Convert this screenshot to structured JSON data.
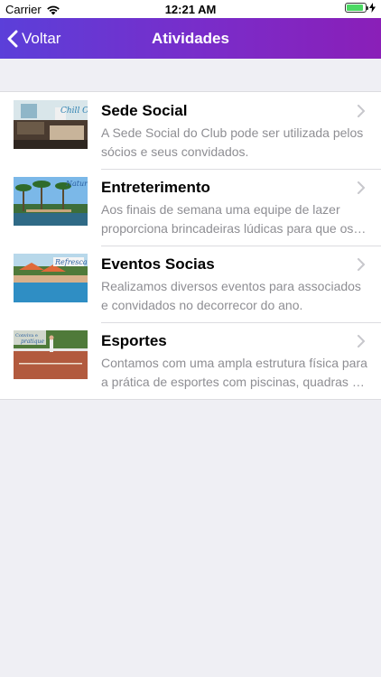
{
  "status_bar": {
    "carrier": "Carrier",
    "time": "12:21 AM",
    "battery_level": 0.9
  },
  "nav": {
    "back_label": "Voltar",
    "title": "Atividades",
    "gradient_start": "#5b3fd9",
    "gradient_end": "#8a1fb8"
  },
  "activities": [
    {
      "title": "Sede Social",
      "description": "A Sede Social do Club pode ser utilizada pelos sócios e seus convidados.",
      "thumb_caption": "Chill Out!",
      "thumb_icon": "lounge-photo"
    },
    {
      "title": "Entreterimento",
      "description": "Aos finais de semana uma equipe de lazer proporciona brincadeiras lúdicas para que os pequenos se divirtam.",
      "thumb_caption": "Natureza",
      "thumb_icon": "palm-trees-photo"
    },
    {
      "title": "Eventos Socias",
      "description": "Realizamos diversos eventos para associados e convidados no decorrecor do ano.",
      "thumb_caption": "Refrescar",
      "thumb_icon": "pool-photo"
    },
    {
      "title": "Esportes",
      "description": "Contamos com uma ampla estrutura física para a prática de esportes com piscinas, quadras e campos.",
      "thumb_caption": "Conviva e pratique esportes",
      "thumb_icon": "tennis-photo"
    }
  ]
}
